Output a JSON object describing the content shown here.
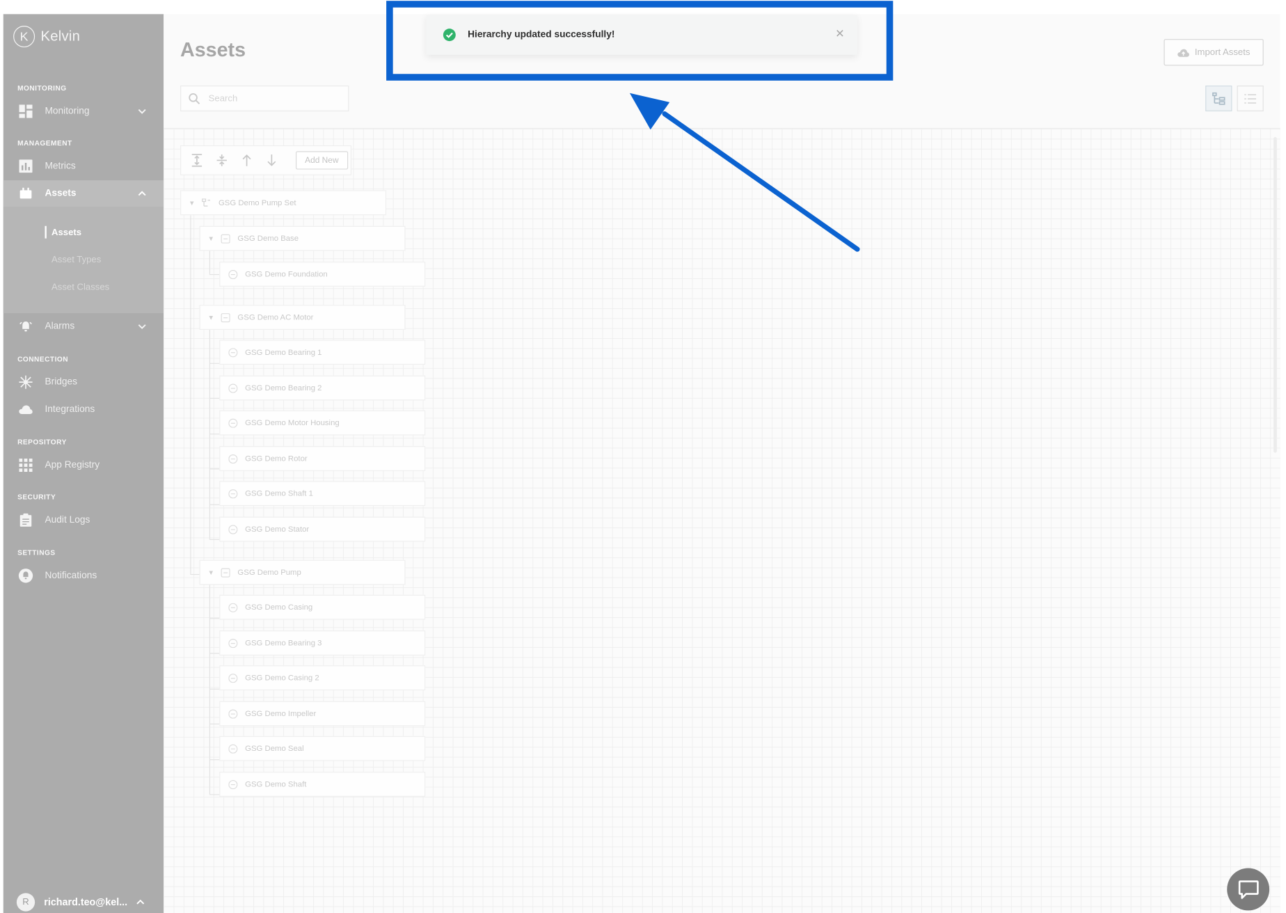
{
  "brand": {
    "logo_letter": "K",
    "name": "Kelvin"
  },
  "sidebar": {
    "sections": {
      "monitoring": "MONITORING",
      "management": "MANAGEMENT",
      "connection": "CONNECTION",
      "repository": "REPOSITORY",
      "security": "SECURITY",
      "settings": "SETTINGS"
    },
    "items": {
      "monitoring": "Monitoring",
      "metrics": "Metrics",
      "assets": "Assets",
      "alarms": "Alarms",
      "bridges": "Bridges",
      "integrations": "Integrations",
      "app_registry": "App Registry",
      "audit_logs": "Audit Logs",
      "notifications": "Notifications"
    },
    "assets_submenu": [
      "Assets",
      "Asset Types",
      "Asset Classes"
    ],
    "user": {
      "initial": "R",
      "email": "richard.teo@kel..."
    }
  },
  "header": {
    "title": "Assets",
    "import_label": "Import Assets"
  },
  "search": {
    "placeholder": "Search"
  },
  "toolbar": {
    "add_new_label": "Add New"
  },
  "tree": {
    "root": "GSG Demo Pump Set",
    "groups": [
      {
        "label": "GSG Demo Base",
        "children": [
          "GSG Demo Foundation"
        ]
      },
      {
        "label": "GSG Demo AC Motor",
        "children": [
          "GSG Demo Bearing 1",
          "GSG Demo Bearing 2",
          "GSG Demo Motor Housing",
          "GSG Demo Rotor",
          "GSG Demo Shaft 1",
          "GSG Demo Stator"
        ]
      },
      {
        "label": "GSG Demo Pump",
        "children": [
          "GSG Demo Casing",
          "GSG Demo Bearing 3",
          "GSG Demo Casing 2",
          "GSG Demo Impeller",
          "GSG Demo Seal",
          "GSG Demo Shaft"
        ]
      }
    ]
  },
  "toast": {
    "message": "Hierarchy updated successfully!"
  },
  "colors": {
    "highlight": "#0b62d0",
    "success": "#2fb36b",
    "sidebar": "#acacac"
  },
  "icons": [
    "kelvin-logo-icon",
    "dashboard-icon",
    "chevron-down-icon",
    "bar-chart-icon",
    "assets-icon",
    "chevron-up-icon",
    "alarm-bell-icon",
    "bridges-icon",
    "cloud-icon",
    "grid-icon",
    "clipboard-icon",
    "notification-icon",
    "cloud-upload-icon",
    "search-icon",
    "tree-view-icon",
    "list-view-icon",
    "expand-all-icon",
    "collapse-all-icon",
    "arrow-up-icon",
    "arrow-down-icon",
    "caret-down-icon",
    "hierarchy-icon",
    "asset-node-icon",
    "check-circle-icon",
    "close-icon",
    "chat-icon"
  ]
}
